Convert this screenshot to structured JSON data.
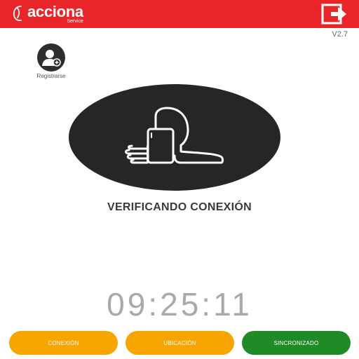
{
  "header": {
    "brand": "acciona",
    "brand_sub": "Service",
    "logout_icon": "logout-icon"
  },
  "version": "V2.7",
  "register": {
    "label": "Registrarse",
    "icon": "add-user-icon"
  },
  "main": {
    "icon": "phone-hand-icon",
    "status": "VERIFICANDO CONEXIÓN",
    "clock": "09:25:11"
  },
  "buttons": {
    "conexion": "CONEXIÓN",
    "ubicacion": "UBICACIÓN",
    "sincronizado": "SINCRONIZADO"
  },
  "colors": {
    "header": "#e8262a",
    "orange": "#f7a500",
    "green": "#1f8a26",
    "circle": "#262626"
  }
}
